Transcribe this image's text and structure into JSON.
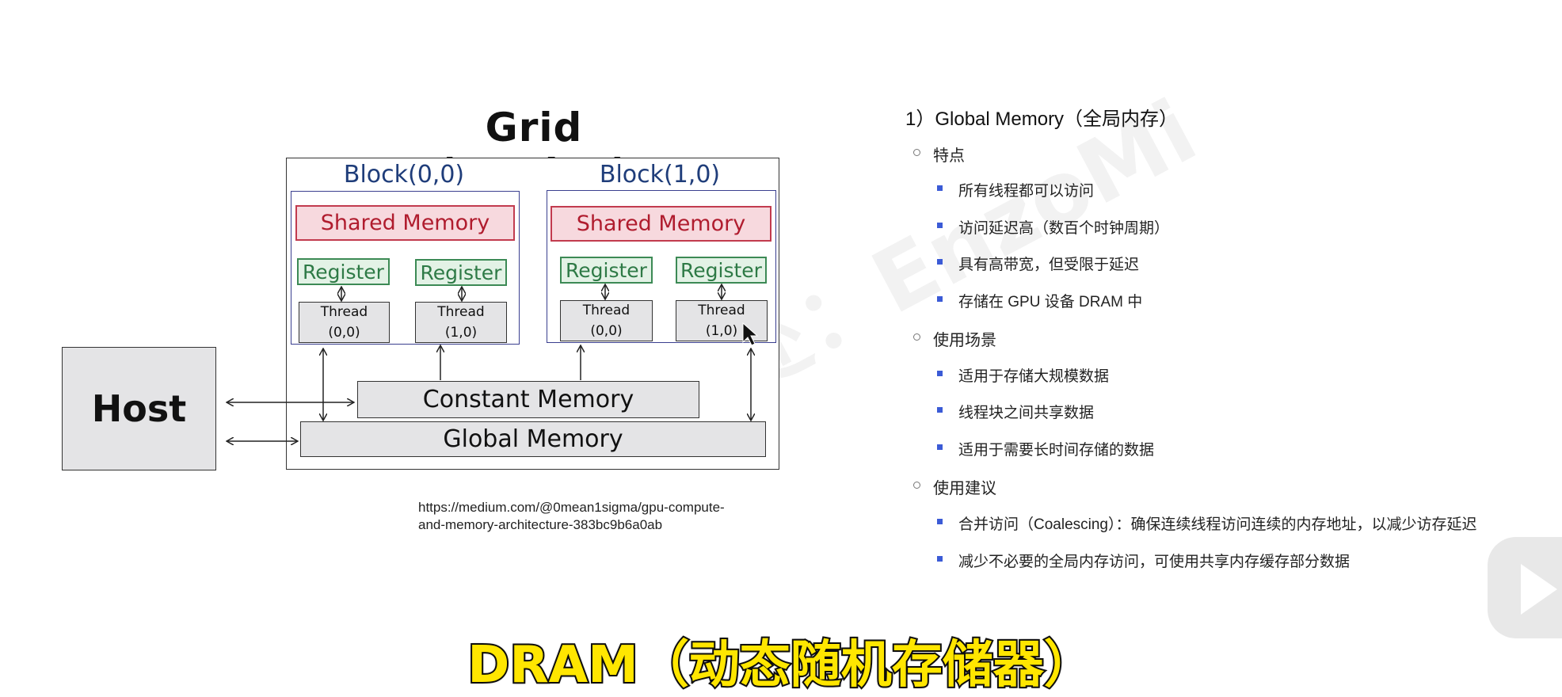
{
  "diagram": {
    "title": "Grid (Device)",
    "blocks": [
      {
        "label": "Block(0,0)",
        "shared": "Shared Memory",
        "registers": [
          "Register",
          "Register"
        ],
        "threads": [
          {
            "name": "Thread",
            "idx": "(0,0)"
          },
          {
            "name": "Thread",
            "idx": "(1,0)"
          }
        ]
      },
      {
        "label": "Block(1,0)",
        "shared": "Shared Memory",
        "registers": [
          "Register",
          "Register"
        ],
        "threads": [
          {
            "name": "Thread",
            "idx": "(0,0)"
          },
          {
            "name": "Thread",
            "idx": "(1,0)"
          }
        ]
      }
    ],
    "constant_memory": "Constant Memory",
    "global_memory": "Global Memory",
    "host": "Host",
    "source_url_line1": "https://medium.com/@0mean1sigma/gpu-compute-",
    "source_url_line2": "and-memory-architecture-383bc9b6a0ab"
  },
  "notes": {
    "heading": "1）Global Memory（全局内存）",
    "features_label": "特点",
    "features": [
      "所有线程都可以访问",
      "访问延迟高（数百个时钟周期）",
      "具有高带宽，但受限于延迟",
      "存储在 GPU 设备 DRAM 中"
    ],
    "scenarios_label": "使用场景",
    "scenarios": [
      "适用于存储大规模数据",
      "线程块之间共享数据",
      "适用于需要长时间存储的数据"
    ],
    "advice_label": "使用建议",
    "advice": [
      "合并访问（Coalescing）：确保连续线程访问连续的内存地址，以减少访存延迟",
      "减少不必要的全局内存访问，可使用共享内存缓存部分数据"
    ]
  },
  "watermark": "出处：EnzoMi",
  "caption": "DRAM（动态随机存储器）",
  "colors": {
    "caption_fill": "#ffe600",
    "bullet_square": "#3b5bd6",
    "shared_memory_border": "#c23b4e",
    "register_border": "#3c8a55",
    "block_label": "#1f3d7a"
  }
}
